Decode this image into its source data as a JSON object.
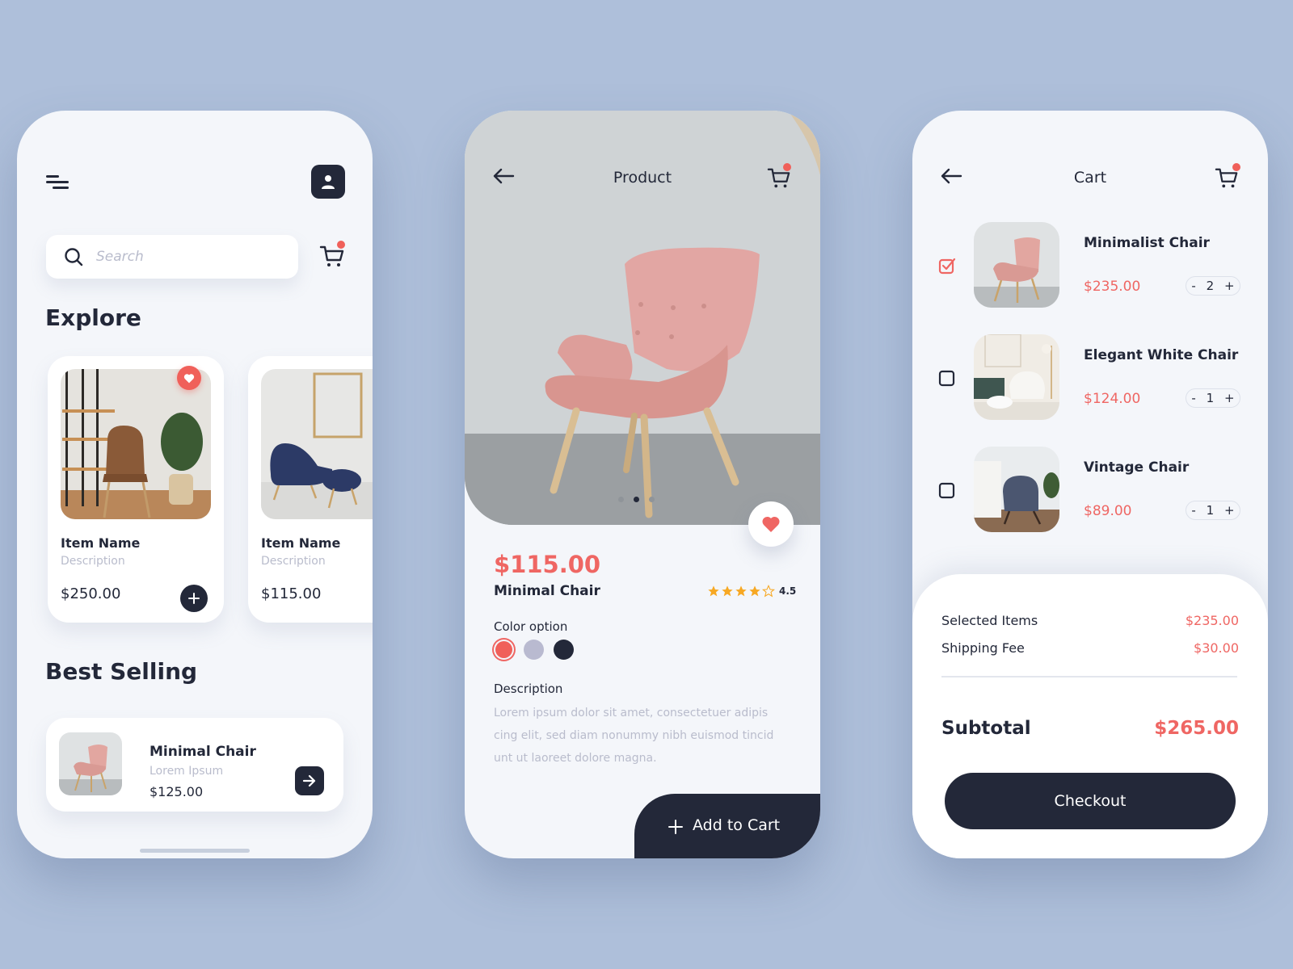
{
  "colors": {
    "background": "#aebfda",
    "screen": "#f4f6fa",
    "dark": "#232839",
    "accent": "#ef6663",
    "muted": "#b9bccc",
    "star": "#f7a823"
  },
  "explore_screen": {
    "menu_icon": "menu-icon",
    "profile_icon": "user-icon",
    "search": {
      "placeholder": "Search",
      "value": ""
    },
    "cart_icon": "cart-icon",
    "cart_has_badge": true,
    "explore_title": "Explore",
    "explore_items": [
      {
        "name": "Item Name",
        "description": "Description",
        "price": "$250.00",
        "favorited": true,
        "image": "brown leather chair with plant and shelf"
      },
      {
        "name": "Item Name",
        "description": "Description",
        "price": "$115.00",
        "favorited": false,
        "image": "navy blue lounge chair with ottoman"
      }
    ],
    "best_selling_title": "Best Selling",
    "best_selling_items": [
      {
        "name": "Minimal Chair",
        "subtitle": "Lorem Ipsum",
        "price": "$125.00",
        "image": "pink armchair"
      }
    ]
  },
  "product_screen": {
    "title": "Product",
    "image_page": {
      "current": 2,
      "total": 3
    },
    "favorited": true,
    "price": "$115.00",
    "name": "Minimal Chair",
    "rating": {
      "value": "4.5",
      "stars_filled": 4,
      "stars_total": 5
    },
    "color_label": "Color option",
    "colors": [
      {
        "name": "coral",
        "hex": "#f0605a",
        "selected": true
      },
      {
        "name": "lavender grey",
        "hex": "#b9bad0",
        "selected": false
      },
      {
        "name": "navy",
        "hex": "#232839",
        "selected": false
      }
    ],
    "description_label": "Description",
    "description": "Lorem ipsum dolor sit amet, consectetuer adipis cing elit, sed diam nonummy nibh euismod tincid unt ut laoreet dolore magna.",
    "add_to_cart_label": "Add to Cart"
  },
  "cart_screen": {
    "title": "Cart",
    "items": [
      {
        "name": "Minimalist Chair",
        "price": "$235.00",
        "quantity": "2",
        "checked": true,
        "image": "pink armchair"
      },
      {
        "name": "Elegant White Chair",
        "price": "$124.00",
        "quantity": "1",
        "checked": false,
        "image": "white chair with ottoman"
      },
      {
        "name": "Vintage Chair",
        "price": "$89.00",
        "quantity": "1",
        "checked": false,
        "image": "grey rocking chair"
      }
    ],
    "stepper_minus": "-",
    "stepper_plus": "+",
    "summary": {
      "selected_label": "Selected Items",
      "selected_value": "$235.00",
      "shipping_label": "Shipping Fee",
      "shipping_value": "$30.00",
      "subtotal_label": "Subtotal",
      "subtotal_value": "$265.00"
    },
    "checkout_label": "Checkout"
  }
}
